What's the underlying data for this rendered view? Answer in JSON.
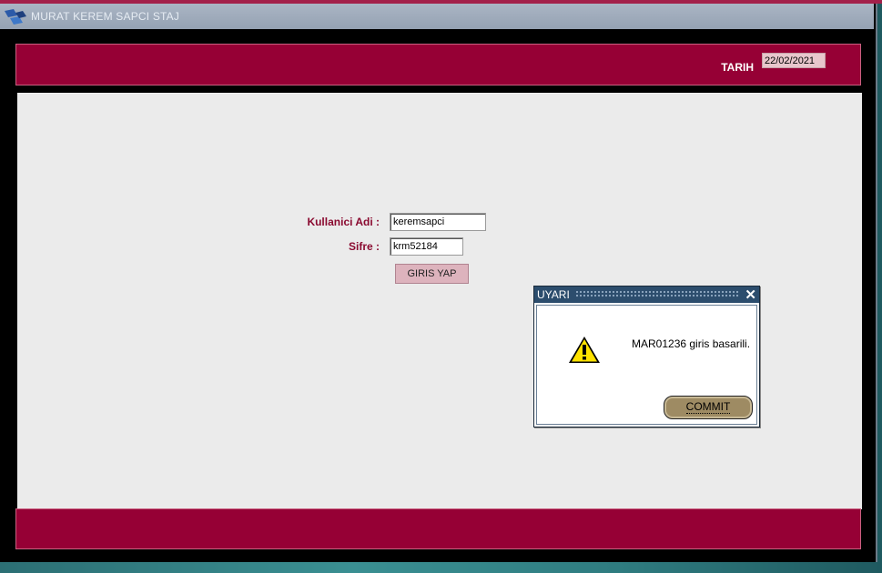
{
  "app": {
    "title": "MURAT KEREM SAPCI STAJ"
  },
  "header": {
    "date_label": "TARIH",
    "date_value": "22/02/2021"
  },
  "login_form": {
    "username_label": "Kullanici Adi :",
    "username_value": "keremsapci",
    "password_label": "Sifre :",
    "password_value": "krm52184",
    "login_button": "GIRIS YAP"
  },
  "dialog": {
    "title": "UYARI",
    "message": "MAR01236 giris basarili.",
    "button": "COMMIT",
    "close_symbol": "✕"
  },
  "colors": {
    "brand_band": "#960035",
    "label_text": "#8a0a30",
    "dialog_titlebar": "#2c4d6d"
  }
}
